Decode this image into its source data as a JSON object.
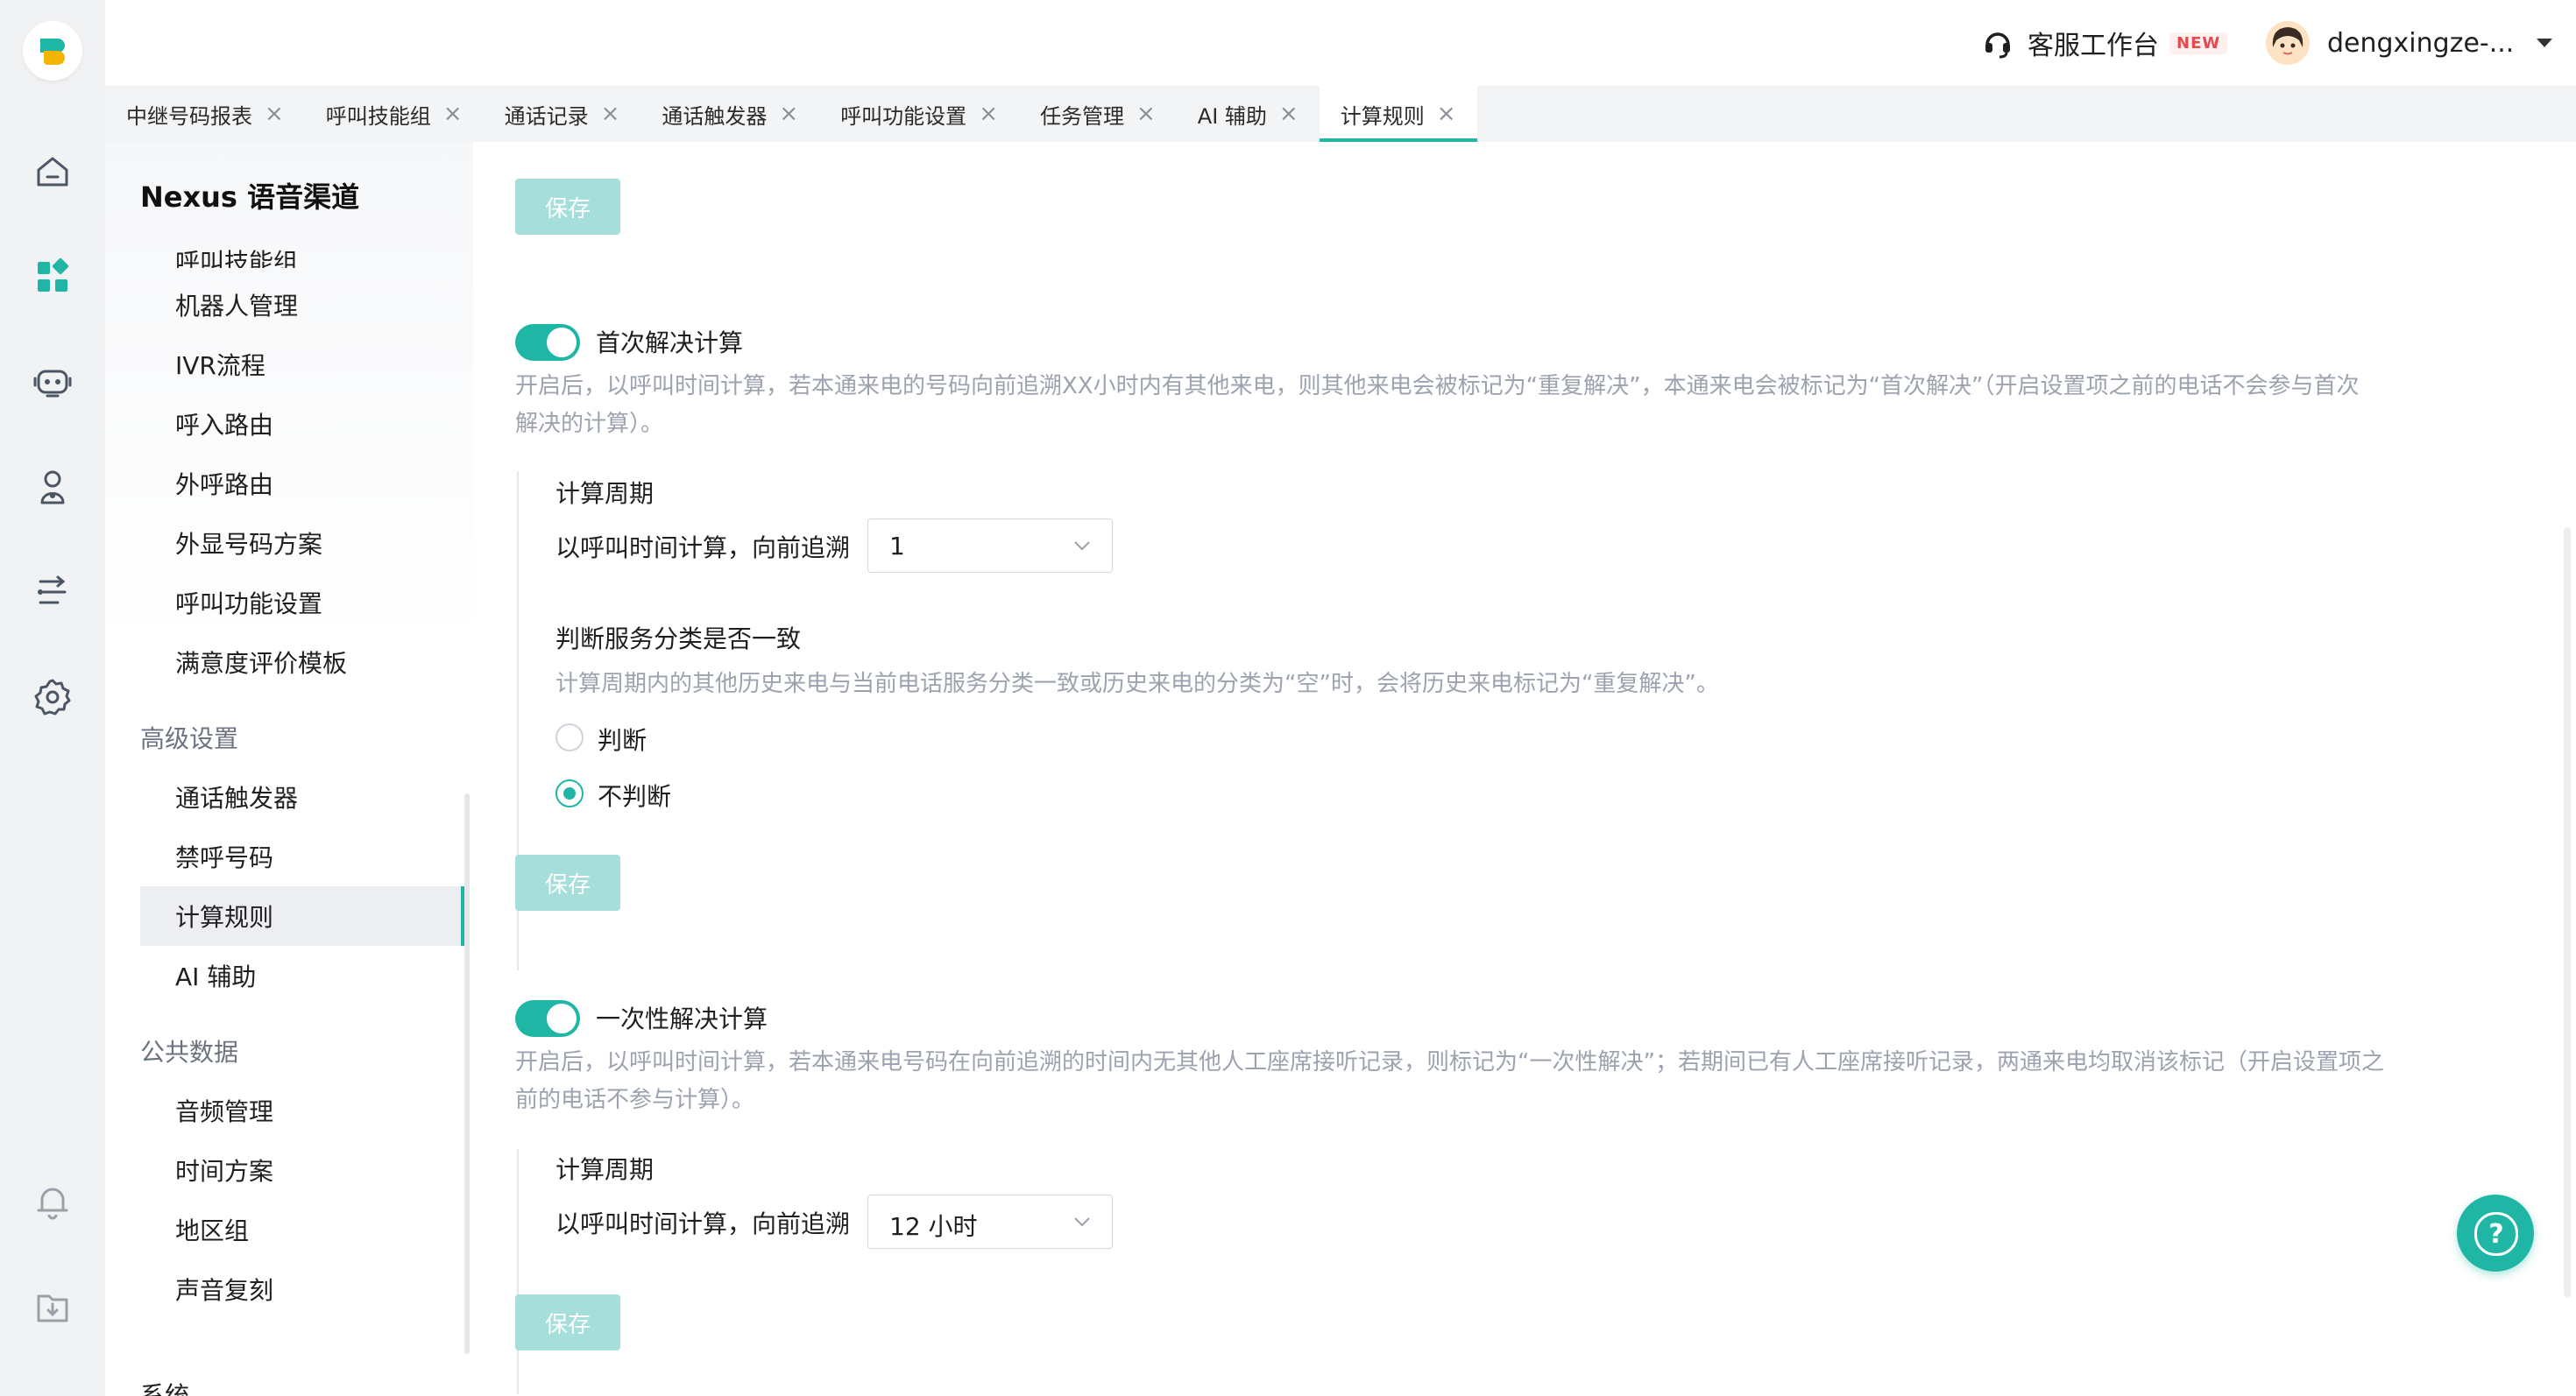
{
  "header": {
    "workbench_label": "客服工作台",
    "new_badge": "NEW",
    "username": "dengxingze-..."
  },
  "tabs": [
    {
      "label": "中继号码报表"
    },
    {
      "label": "呼叫技能组"
    },
    {
      "label": "通话记录"
    },
    {
      "label": "通话触发器"
    },
    {
      "label": "呼叫功能设置"
    },
    {
      "label": "任务管理"
    },
    {
      "label": "AI 辅助"
    },
    {
      "label": "计算规则",
      "active": true
    }
  ],
  "sidebar": {
    "title": "Nexus 语音渠道",
    "items_top": [
      "呼叫技能组",
      "机器人管理",
      "IVR流程",
      "呼入路由",
      "外呼路由",
      "外显号码方案",
      "呼叫功能设置",
      "满意度评价模板"
    ],
    "group_advanced": "高级设置",
    "items_advanced": [
      "通话触发器",
      "禁呼号码",
      "计算规则",
      "AI 辅助"
    ],
    "group_public": "公共数据",
    "items_public": [
      "音频管理",
      "时间方案",
      "地区组",
      "声音复刻"
    ],
    "group_system": "系统"
  },
  "main": {
    "save_label": "保存",
    "first_resolve": {
      "title": "首次解决计算",
      "enabled": true,
      "desc_line1": "开启后，以呼叫时间计算，若本通来电的号码向前追溯XX小时内有其他来电，则其他来电会被标记为“重复解决”，本通来电会被标记为“首次解决”（开启设置项之前的电话不会参与首次",
      "desc_line2": "解决的计算）。",
      "period_label": "计算周期",
      "lookback_label": "以呼叫时间计算，向前追溯",
      "lookback_value": "1",
      "judge_title": "判断服务分类是否一致",
      "judge_desc": "计算周期内的其他历史来电与当前电话服务分类一致或历史来电的分类为“空”时，会将历史来电标记为“重复解决”。",
      "radio_judge": "判断",
      "radio_no_judge": "不判断",
      "selected": "不判断"
    },
    "one_time_resolve": {
      "title": "一次性解决计算",
      "enabled": true,
      "desc_line1": "开启后，以呼叫时间计算，若本通来电号码在向前追溯的时间内无其他人工座席接听记录，则标记为“一次性解决”；若期间已有人工座席接听记录，两通来电均取消该标记（开启设置项之",
      "desc_line2": "前的电话不参与计算）。",
      "period_label": "计算周期",
      "lookback_label": "以呼叫时间计算，向前追溯",
      "lookback_value": "12 小时"
    }
  },
  "help_label": "?",
  "colors": {
    "accent": "#1fb6a6",
    "save_disabled": "#a5dedb"
  }
}
